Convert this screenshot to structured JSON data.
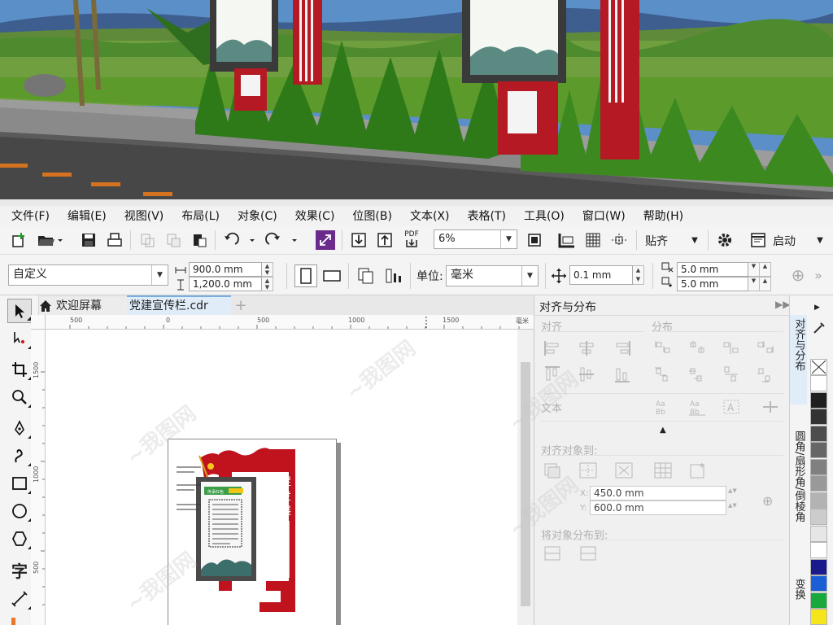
{
  "menu": [
    {
      "label": "文件(F)"
    },
    {
      "label": "编辑(E)"
    },
    {
      "label": "视图(V)"
    },
    {
      "label": "布局(L)"
    },
    {
      "label": "对象(C)"
    },
    {
      "label": "效果(C)"
    },
    {
      "label": "位图(B)"
    },
    {
      "label": "文本(X)"
    },
    {
      "label": "表格(T)"
    },
    {
      "label": "工具(O)"
    },
    {
      "label": "窗口(W)"
    },
    {
      "label": "帮助(H)"
    }
  ],
  "toolbar": {
    "zoom": "6%",
    "pdf_label": "PDF",
    "snap_label": "贴齐",
    "launch_label": "启动"
  },
  "property_bar": {
    "page_size": "自定义",
    "width": "900.0 mm",
    "height": "1,200.0 mm",
    "units_label": "单位:",
    "units_value": "毫米",
    "nudge": "0.1 mm",
    "dup_x": "5.0 mm",
    "dup_y": "5.0 mm"
  },
  "tabs": {
    "welcome": "欢迎屏幕",
    "document": "党建宣传栏.cdr",
    "add": "+"
  },
  "ruler": {
    "h_ticks": [
      "500",
      "0",
      "500",
      "1000",
      "1500"
    ],
    "h_unit": "毫米",
    "v_ticks": [
      "1500",
      "1000",
      "500"
    ]
  },
  "design": {
    "banner_chars": [
      "促",
      "发",
      "展"
    ],
    "panel_header": "传承红色"
  },
  "docker": {
    "title": "对齐与分布",
    "align_section": "对齐",
    "distribute_section": "分布",
    "text_section": "文本",
    "align_to_section": "对齐对象到:",
    "x_label": "X:",
    "y_label": "Y:",
    "x_value": "450.0 mm",
    "y_value": "600.0 mm",
    "distribute_to_section": "将对象分布到:"
  },
  "vertical_tabs": [
    "对齐与分布",
    "圆角/扇形角/倒棱角",
    "变换"
  ],
  "palette": [
    "#ffffff",
    "#202020",
    "#333333",
    "#4d4d4d",
    "#666666",
    "#808080",
    "#999999",
    "#b3b3b3",
    "#cccccc",
    "#e6e6e6",
    "#ffffff",
    "#1a1a8c",
    "#1a5fd6",
    "#19a83c",
    "#f5e61c"
  ]
}
